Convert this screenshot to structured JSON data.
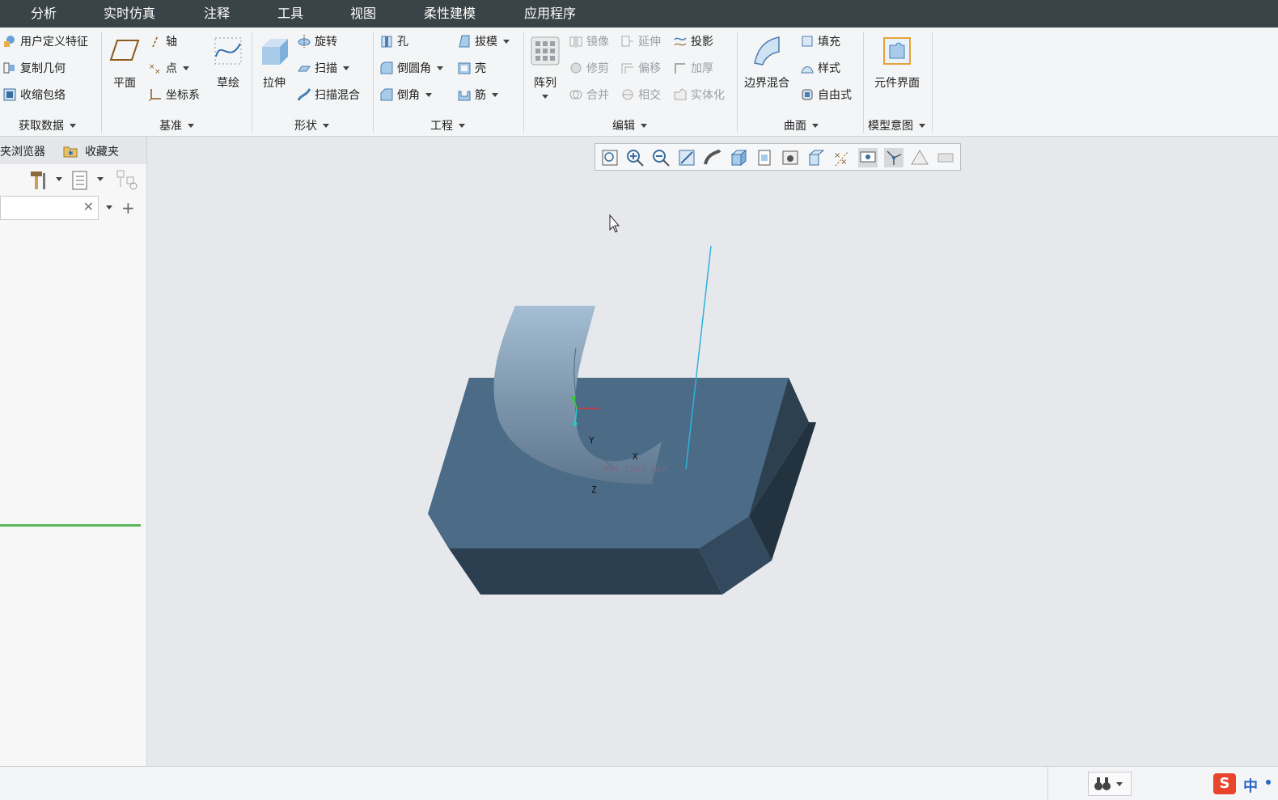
{
  "menu_tabs": [
    "分析",
    "实时仿真",
    "注释",
    "工具",
    "视图",
    "柔性建模",
    "应用程序"
  ],
  "groups": {
    "get_data": {
      "label": "获取数据",
      "items": [
        "用户定义特征",
        "复制几何",
        "收缩包络"
      ]
    },
    "datum": {
      "label": "基准",
      "plane": "平面",
      "axis": "轴",
      "point": "点",
      "csys": "坐标系",
      "sketch": "草绘"
    },
    "shapes": {
      "label": "形状",
      "extrude": "拉伸",
      "revolve": "旋转",
      "sweep": "扫描",
      "swept_blend": "扫描混合"
    },
    "engineering": {
      "label": "工程",
      "hole": "孔",
      "round": "倒圆角",
      "chamfer": "倒角",
      "draft": "拔模",
      "shell": "壳",
      "rib": "筋"
    },
    "editing": {
      "label": "编辑",
      "pattern": "阵列",
      "mirror": "镜像",
      "trim": "修剪",
      "merge": "合并",
      "extend": "延伸",
      "offset": "偏移",
      "intersect": "相交",
      "project": "投影",
      "thicken": "加厚",
      "solidify": "实体化"
    },
    "surfaces": {
      "label": "曲面",
      "boundary_blend": "边界混合",
      "fill": "填充",
      "style": "样式",
      "freestyle": "自由式"
    },
    "model_intent": {
      "label": "模型意图",
      "component_interface": "元件界面"
    }
  },
  "left_panel": {
    "tab1": "夹浏览器",
    "tab2": "收藏夹",
    "search_value": ""
  },
  "viewport": {
    "csys_label": "PRT_CSYS_DEF",
    "axis_x": "X",
    "axis_y": "Y",
    "axis_z": "Z"
  },
  "view_toolbar_icons": [
    "refit-icon",
    "zoom-in-icon",
    "zoom-out-icon",
    "repaint-icon",
    "perspective-icon",
    "display-style-icon",
    "saved-views-icon",
    "view-manager-icon",
    "annotation-display-icon",
    "datum-display-icon",
    "spin-center-icon",
    "appearance-icon",
    "plane-display-icon",
    "point-display-icon",
    "csys-display-icon"
  ],
  "colors": {
    "menubar": "#3a4347",
    "ribbon": "#f4f5f6",
    "viewport_bg": "#e6e8ec",
    "model_top": "#4a6a86",
    "model_side": "#2a3e4f",
    "surface": "#8aa4ba"
  },
  "status": {
    "ime_label": "中"
  }
}
